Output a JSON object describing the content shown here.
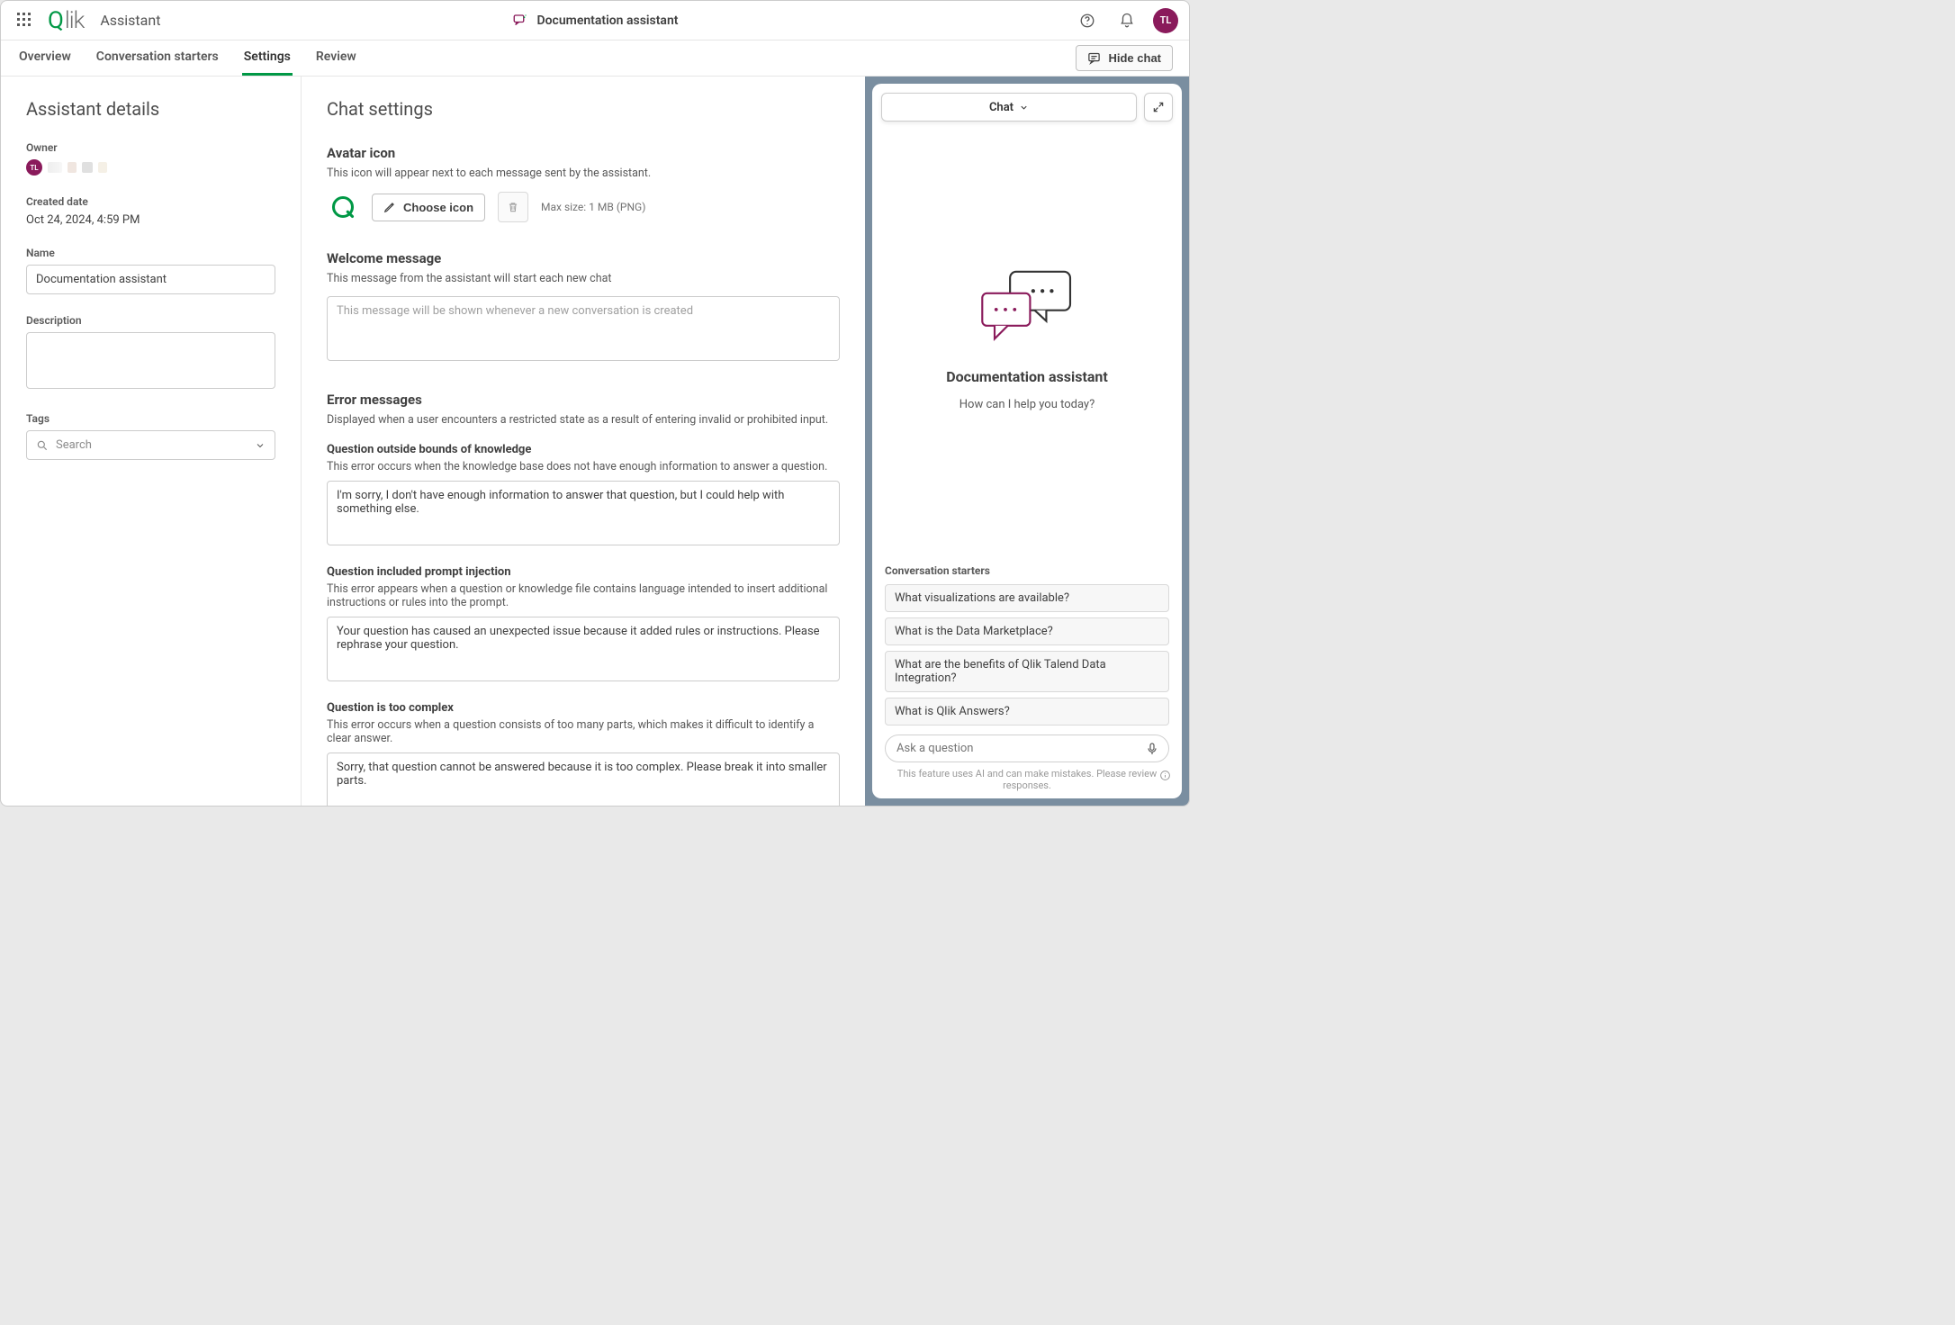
{
  "topbar": {
    "brand_prefix": "Q",
    "brand_rest": "lik",
    "app_title": "Assistant",
    "center_title": "Documentation assistant",
    "avatar_initials": "TL"
  },
  "tabs": {
    "overview": "Overview",
    "starters": "Conversation starters",
    "settings": "Settings",
    "review": "Review",
    "hide_chat": "Hide chat"
  },
  "sidebar": {
    "heading": "Assistant details",
    "owner_label": "Owner",
    "owner_initials": "TL",
    "created_label": "Created date",
    "created_value": "Oct 24, 2024, 4:59 PM",
    "name_label": "Name",
    "name_value": "Documentation assistant",
    "description_label": "Description",
    "description_value": "",
    "tags_label": "Tags",
    "tags_placeholder": "Search"
  },
  "content": {
    "heading": "Chat settings",
    "avatar_section_title": "Avatar icon",
    "avatar_section_sub": "This icon will appear next to each message sent by the assistant.",
    "choose_icon_label": "Choose icon",
    "max_size_hint": "Max size: 1 MB (PNG)",
    "welcome_title": "Welcome message",
    "welcome_sub": "This message from the assistant will start each new chat",
    "welcome_placeholder": "This message will be shown whenever a new conversation is created",
    "welcome_value": "",
    "errors_title": "Error messages",
    "errors_sub": "Displayed when a user encounters a restricted state as a result of entering invalid or prohibited input.",
    "q_outside_title": "Question outside bounds of knowledge",
    "q_outside_sub": "This error occurs when the knowledge base does not have enough information to answer a question.",
    "q_outside_value": "I'm sorry, I don't have enough information to answer that question, but I could help with something else.",
    "q_inject_title": "Question included prompt injection",
    "q_inject_sub": "This error appears when a question or knowledge file contains language intended to insert additional instructions or rules into the prompt.",
    "q_inject_value": "Your question has caused an unexpected issue because it added rules or instructions. Please rephrase your question.",
    "q_complex_title": "Question is too complex",
    "q_complex_sub": "This error occurs when a question consists of too many parts, which makes it difficult to identify a clear answer.",
    "q_complex_value": "Sorry, that question cannot be answered because it is too complex. Please break it into smaller parts."
  },
  "chat": {
    "dropdown_label": "Chat",
    "assistant_name": "Documentation assistant",
    "prompt": "How can I help you today?",
    "starters_label": "Conversation starters",
    "starters": [
      "What visualizations are available?",
      "What is the Data Marketplace?",
      "What are the benefits of Qlik Talend Data Integration?",
      "What is Qlik Answers?"
    ],
    "ask_placeholder": "Ask a question",
    "disclaimer": "This feature uses AI and can make mistakes. Please review responses."
  }
}
